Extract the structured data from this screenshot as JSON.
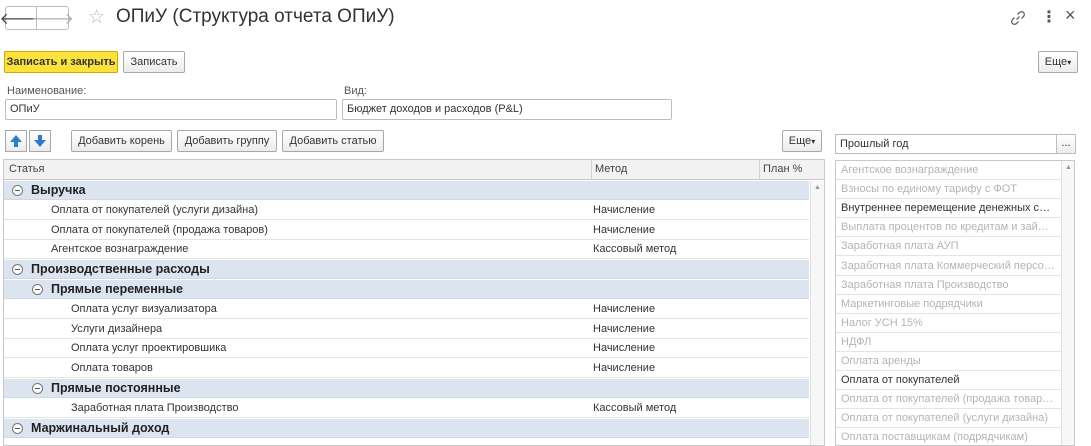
{
  "window": {
    "title": "ОПиУ (Структура отчета ОПиУ)",
    "back_glyph": "🡐",
    "fwd_glyph": "🡒",
    "star_glyph": "☆",
    "kebab_glyph": "⋮",
    "close_glyph": "×"
  },
  "commandbar": {
    "save_close_label": "Записать и закрыть",
    "save_label": "Записать",
    "more_label": "Еще"
  },
  "form": {
    "name_label": "Наименование:",
    "name_value": "ОПиУ",
    "kind_label": "Вид:",
    "kind_value": "Бюджет доходов и расходов (P&L)"
  },
  "toolbar": {
    "add_root_label": "Добавить корень",
    "add_group_label": "Добавить группу",
    "add_item_label": "Добавить статью",
    "more_label": "Еще"
  },
  "table": {
    "columns": [
      "Статья",
      "Метод",
      "План %"
    ],
    "rows": [
      {
        "name": "Выручка",
        "method": "",
        "group": true,
        "level": 0
      },
      {
        "name": "Оплата от покупателей (услуги дизайна)",
        "method": "Начисление",
        "group": false,
        "level": 1
      },
      {
        "name": "Оплата от покупателей (продажа товаров)",
        "method": "Начисление",
        "group": false,
        "level": 1
      },
      {
        "name": "Агентское вознаграждение",
        "method": "Кассовый метод",
        "group": false,
        "level": 1
      },
      {
        "name": "Производственные расходы",
        "method": "",
        "group": true,
        "level": 0
      },
      {
        "name": "Прямые переменные",
        "method": "",
        "group": true,
        "level": 1
      },
      {
        "name": "Оплата услуг визуализатора",
        "method": "Начисление",
        "group": false,
        "level": 2
      },
      {
        "name": "Услуги дизайнера",
        "method": "Начисление",
        "group": false,
        "level": 2
      },
      {
        "name": "Оплата услуг проектировшика",
        "method": "Начисление",
        "group": false,
        "level": 2
      },
      {
        "name": "Оплата товаров",
        "method": "Начисление",
        "group": false,
        "level": 2
      },
      {
        "name": "Прямые постоянные",
        "method": "",
        "group": true,
        "level": 1
      },
      {
        "name": "Заработная плата Производство",
        "method": "Кассовый метод",
        "group": false,
        "level": 2
      },
      {
        "name": "Маржинальный доход",
        "method": "",
        "group": true,
        "level": 0
      }
    ]
  },
  "right_panel": {
    "period_value": "Прошлый год",
    "dots_label": "...",
    "items": [
      {
        "label": "Агентское вознаграждение",
        "active": false
      },
      {
        "label": "Взносы по единому тарифу с ФОТ",
        "active": false
      },
      {
        "label": "Внутреннее перемещение денежных сре...",
        "active": true
      },
      {
        "label": "Выплата процентов по кредитам и займам",
        "active": false
      },
      {
        "label": "Заработная плата АУП",
        "active": false
      },
      {
        "label": "Заработная плата Коммерческий персон...",
        "active": false
      },
      {
        "label": "Заработная плата Производство",
        "active": false
      },
      {
        "label": "Маркетинговые подрядчики",
        "active": false
      },
      {
        "label": "Налог УСН 15%",
        "active": false
      },
      {
        "label": "НДФЛ",
        "active": false
      },
      {
        "label": "Оплата аренды",
        "active": false
      },
      {
        "label": "Оплата от покупателей",
        "active": true
      },
      {
        "label": "Оплата от покупателей (продажа товаров)",
        "active": false
      },
      {
        "label": "Оплата от покупателей (услуги дизайна)",
        "active": false
      },
      {
        "label": "Оплата поставщикам (подрядчикам)",
        "active": false
      }
    ]
  },
  "colors": {
    "primary_button": "#fbe33b",
    "group_row": "#dce4ef",
    "arrow_blue": "#2b7cd3"
  }
}
